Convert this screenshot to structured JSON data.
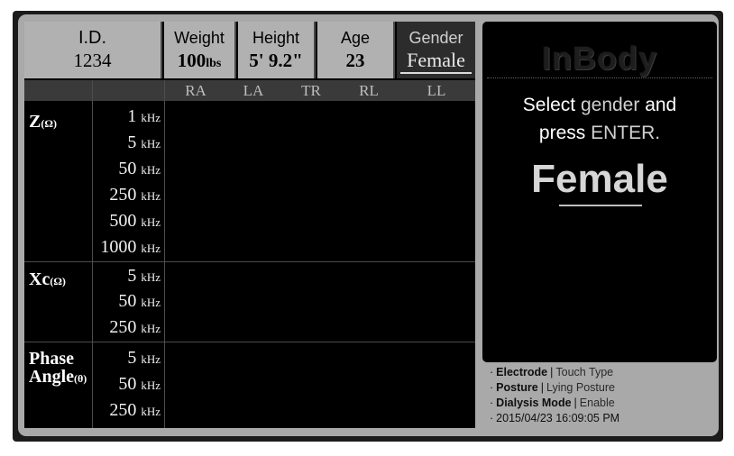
{
  "header": {
    "id": {
      "label": "I.D.",
      "value": "1234"
    },
    "weight": {
      "label": "Weight",
      "value": "100",
      "unit": "lbs"
    },
    "height": {
      "label": "Height",
      "value": "5' 9.2\""
    },
    "age": {
      "label": "Age",
      "value": "23"
    },
    "gender": {
      "label": "Gender",
      "value": "Female"
    }
  },
  "columns": [
    "RA",
    "LA",
    "TR",
    "RL",
    "LL"
  ],
  "groups": [
    {
      "label": "Z",
      "unit": "(Ω)",
      "freqs": [
        {
          "value": "1",
          "unit": "kHz"
        },
        {
          "value": "5",
          "unit": "kHz"
        },
        {
          "value": "50",
          "unit": "kHz"
        },
        {
          "value": "250",
          "unit": "kHz"
        },
        {
          "value": "500",
          "unit": "kHz"
        },
        {
          "value": "1000",
          "unit": "kHz"
        }
      ]
    },
    {
      "label": "Xc",
      "unit": "(Ω)",
      "freqs": [
        {
          "value": "5",
          "unit": "kHz"
        },
        {
          "value": "50",
          "unit": "kHz"
        },
        {
          "value": "250",
          "unit": "kHz"
        }
      ]
    },
    {
      "label_line1": "Phase",
      "label_line2": "Angle",
      "unit": "(θ)",
      "freqs": [
        {
          "value": "5",
          "unit": "kHz"
        },
        {
          "value": "50",
          "unit": "kHz"
        },
        {
          "value": "250",
          "unit": "kHz"
        }
      ]
    }
  ],
  "panel": {
    "logo": "InBody",
    "instruction_1a": "Select ",
    "instruction_1b": "gender",
    "instruction_1c": " and",
    "instruction_2a": "press ",
    "instruction_2b": "ENTER.",
    "selected_gender": "Female"
  },
  "info": {
    "bullet": "·",
    "separator": "|",
    "electrode": {
      "key": "Electrode",
      "value": "Touch Type"
    },
    "posture": {
      "key": "Posture",
      "value": "Lying Posture"
    },
    "dialysis": {
      "key": "Dialysis Mode",
      "value": "Enable"
    },
    "datetime": "2015/04/23 16:09:05 PM"
  },
  "colors": {
    "screen": "#000000",
    "bezel": "#a9a9a9",
    "header_cell": "#b1b1b1",
    "gender_cell": "#2c2c2c"
  }
}
